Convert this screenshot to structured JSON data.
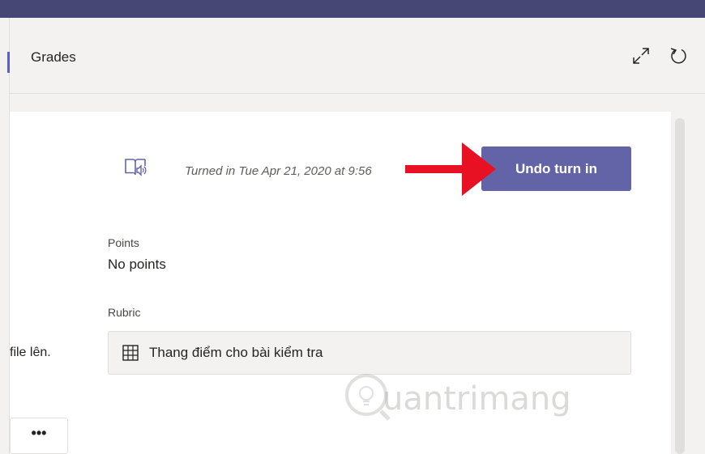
{
  "header": {
    "tab_label": "Grades",
    "expand_icon": "expand-icon",
    "refresh_icon": "refresh-icon"
  },
  "submission": {
    "turned_in_text": "Turned in Tue Apr 21, 2020 at 9:56",
    "undo_button_label": "Undo turn in",
    "button_color": "#6264a7",
    "reader_icon": "immersive-reader-icon",
    "annotation_arrow_color": "#e81123"
  },
  "points": {
    "label": "Points",
    "value": "No points"
  },
  "rubric": {
    "label": "Rubric",
    "value": "Thang điểm cho bài kiểm tra",
    "icon": "table-grid-icon"
  },
  "left_panel": {
    "file_text": "file lên.",
    "more_button_label": "•••"
  },
  "watermark": {
    "text": "uantrimang"
  },
  "colors": {
    "top_bar": "#464775",
    "accent": "#5b5fc7",
    "background": "#f3f2f1"
  }
}
